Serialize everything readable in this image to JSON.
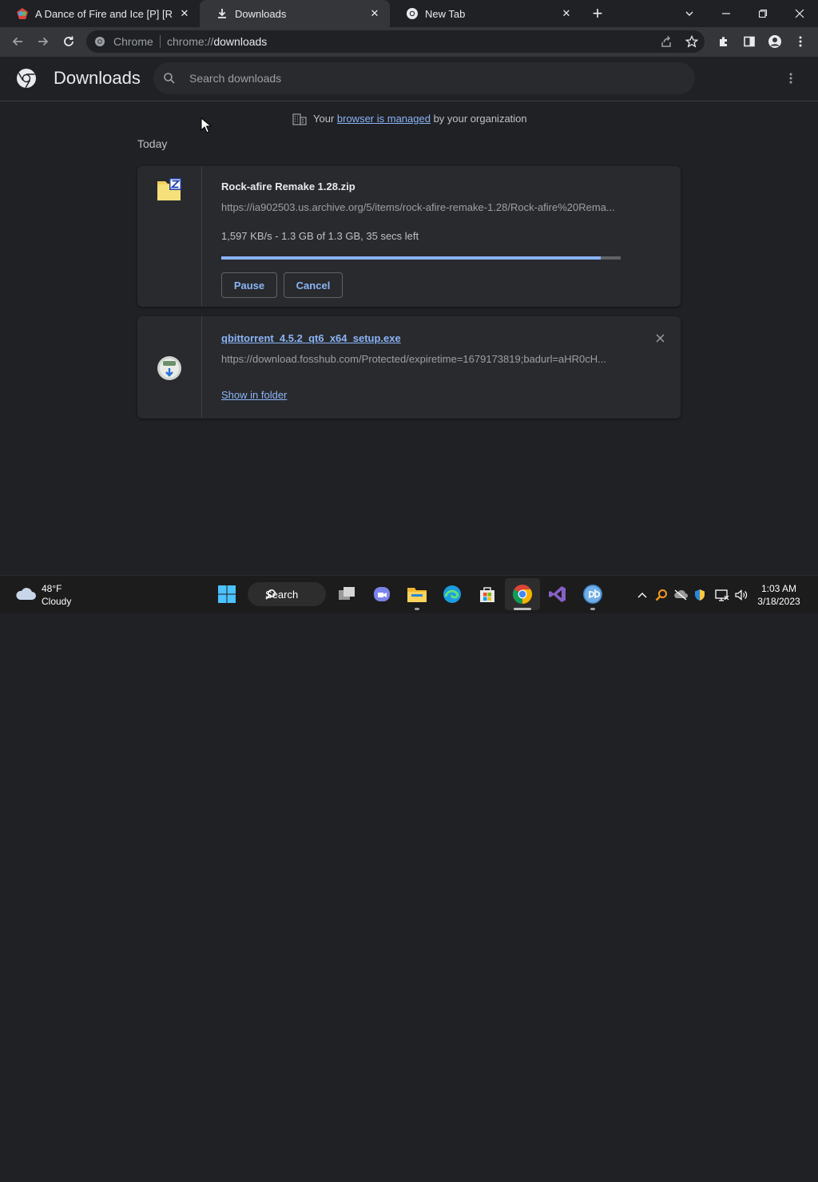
{
  "tabs": [
    {
      "title": "A Dance of Fire and Ice [P] [RUS"
    },
    {
      "title": "Downloads"
    },
    {
      "title": "New Tab"
    }
  ],
  "omnibox": {
    "scheme_label": "Chrome",
    "url_prefix": "chrome://",
    "url_host": "downloads"
  },
  "page": {
    "title": "Downloads",
    "search_placeholder": "Search downloads"
  },
  "managed": {
    "prefix": "Your ",
    "link": "browser is managed",
    "suffix": " by your organization"
  },
  "section": {
    "label": "Today"
  },
  "downloads": [
    {
      "file_name": "Rock-afire Remake 1.28.zip",
      "url": "https://ia902503.us.archive.org/5/items/rock-afire-remake-1.28/Rock-afire%20Rema...",
      "status": "1,597 KB/s - 1.3 GB of 1.3 GB, 35 secs left",
      "progress": 0.95,
      "pause_label": "Pause",
      "cancel_label": "Cancel"
    },
    {
      "file_name": "qbittorrent_4.5.2_qt6_x64_setup.exe",
      "url": "https://download.fosshub.com/Protected/expiretime=1679173819;badurl=aHR0cH...",
      "show_in_folder_label": "Show in folder"
    }
  ],
  "taskbar": {
    "weather_temp": "48°F",
    "weather_desc": "Cloudy",
    "search_label": "Search",
    "time": "1:03 AM",
    "date": "3/18/2023"
  },
  "colors": {
    "accent": "#8ab4f8",
    "background": "#202124",
    "card": "#292a2d",
    "toolbar": "#35363a"
  }
}
